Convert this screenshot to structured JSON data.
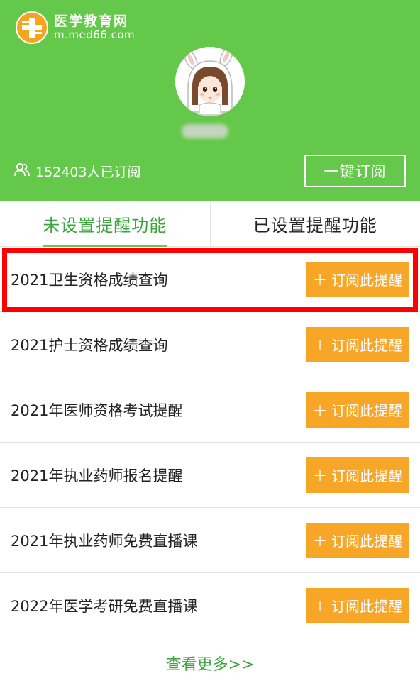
{
  "colors": {
    "brand": "#64c84a",
    "brand_text": "#3aa63a",
    "accent": "#f7a628",
    "highlight": "#ff0000"
  },
  "logo": {
    "name": "医学教育网",
    "url": "m.med66.com",
    "icon": "medical-cross-logo-icon"
  },
  "profile": {
    "avatar_icon": "bunny-girl-avatar-icon"
  },
  "subscribers": {
    "icon": "users-icon",
    "text": "152403人已订阅"
  },
  "one_click_button": "一键订阅",
  "tabs": [
    {
      "label": "未设置提醒功能",
      "active": true
    },
    {
      "label": "已设置提醒功能",
      "active": false
    }
  ],
  "items": [
    {
      "title": "2021卫生资格成绩查询",
      "button": "订阅此提醒",
      "highlighted": true
    },
    {
      "title": "2021护士资格成绩查询",
      "button": "订阅此提醒"
    },
    {
      "title": "2021年医师资格考试提醒",
      "button": "订阅此提醒"
    },
    {
      "title": "2021年执业药师报名提醒",
      "button": "订阅此提醒"
    },
    {
      "title": "2021年执业药师免费直播课",
      "button": "订阅此提醒"
    },
    {
      "title": "2022年医学考研免费直播课",
      "button": "订阅此提醒"
    }
  ],
  "plus_glyph": "+",
  "more_link": "查看更多>>"
}
